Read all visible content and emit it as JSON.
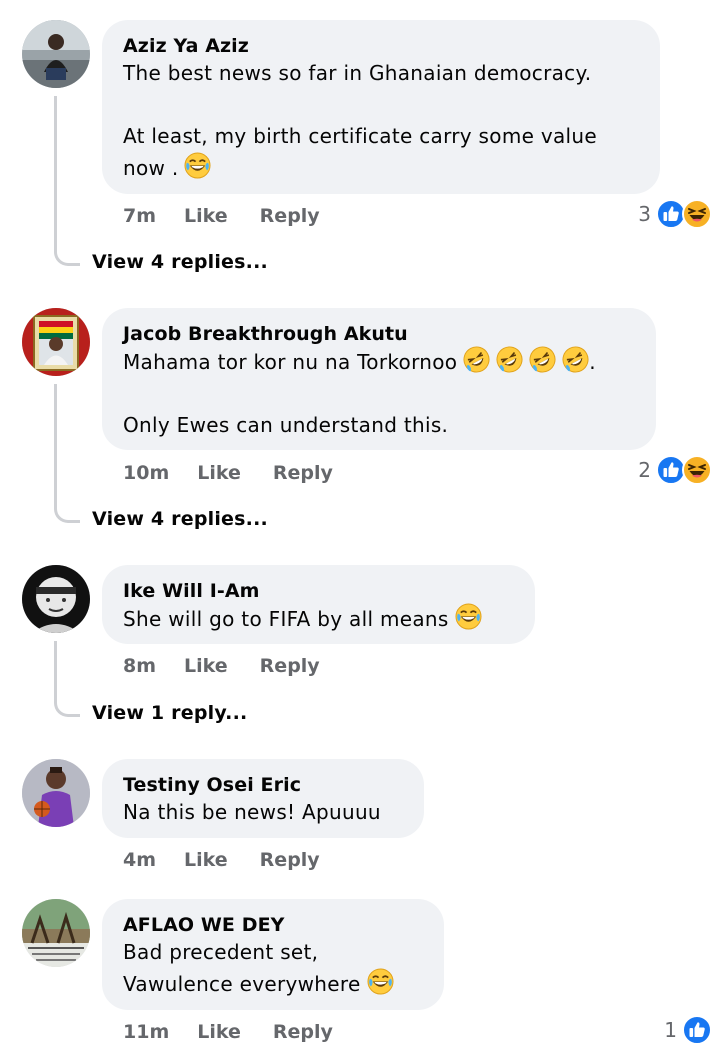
{
  "comments": [
    {
      "author": "Aziz Ya Aziz",
      "text_lines": [
        "The best news so far in Ghanaian democracy.",
        "",
        "At least, my birth certificate carry some value",
        "now ."
      ],
      "time": "7m",
      "like_label": "Like",
      "reply_label": "Reply",
      "reaction_count": "3",
      "view_replies": "View 4 replies..."
    },
    {
      "author": "Jacob Breakthrough Akutu",
      "text_lines": [
        "Mahama tor kor nu na Torkornoo",
        "",
        "Only  Ewes can understand this."
      ],
      "time": "10m",
      "like_label": "Like",
      "reply_label": "Reply",
      "reaction_count": "2",
      "view_replies": "View 4 replies..."
    },
    {
      "author": "Ike Will I-Am",
      "text_lines": [
        "She will go to FIFA by all means"
      ],
      "time": "8m",
      "like_label": "Like",
      "reply_label": "Reply",
      "view_replies": "View 1 reply..."
    },
    {
      "author": "Testiny Osei Eric",
      "text_lines": [
        "Na this be news! Apuuuu"
      ],
      "time": "4m",
      "like_label": "Like",
      "reply_label": "Reply"
    },
    {
      "author": "AFLAO WE DEY",
      "text_lines": [
        "Bad precedent set,",
        "Vawulence everywhere"
      ],
      "time": "11m",
      "like_label": "Like",
      "reply_label": "Reply",
      "reaction_count": "1"
    }
  ],
  "emoji": {
    "tears_of_joy": "face-with-tears-of-joy",
    "rofl": "rolling-on-floor-laughing"
  },
  "colors": {
    "bubble_bg": "#f0f2f5",
    "meta_text": "#65676b",
    "like_blue": "#1877f2",
    "haha_yellow": "#f7b125",
    "thread_line": "#ced0d4"
  }
}
